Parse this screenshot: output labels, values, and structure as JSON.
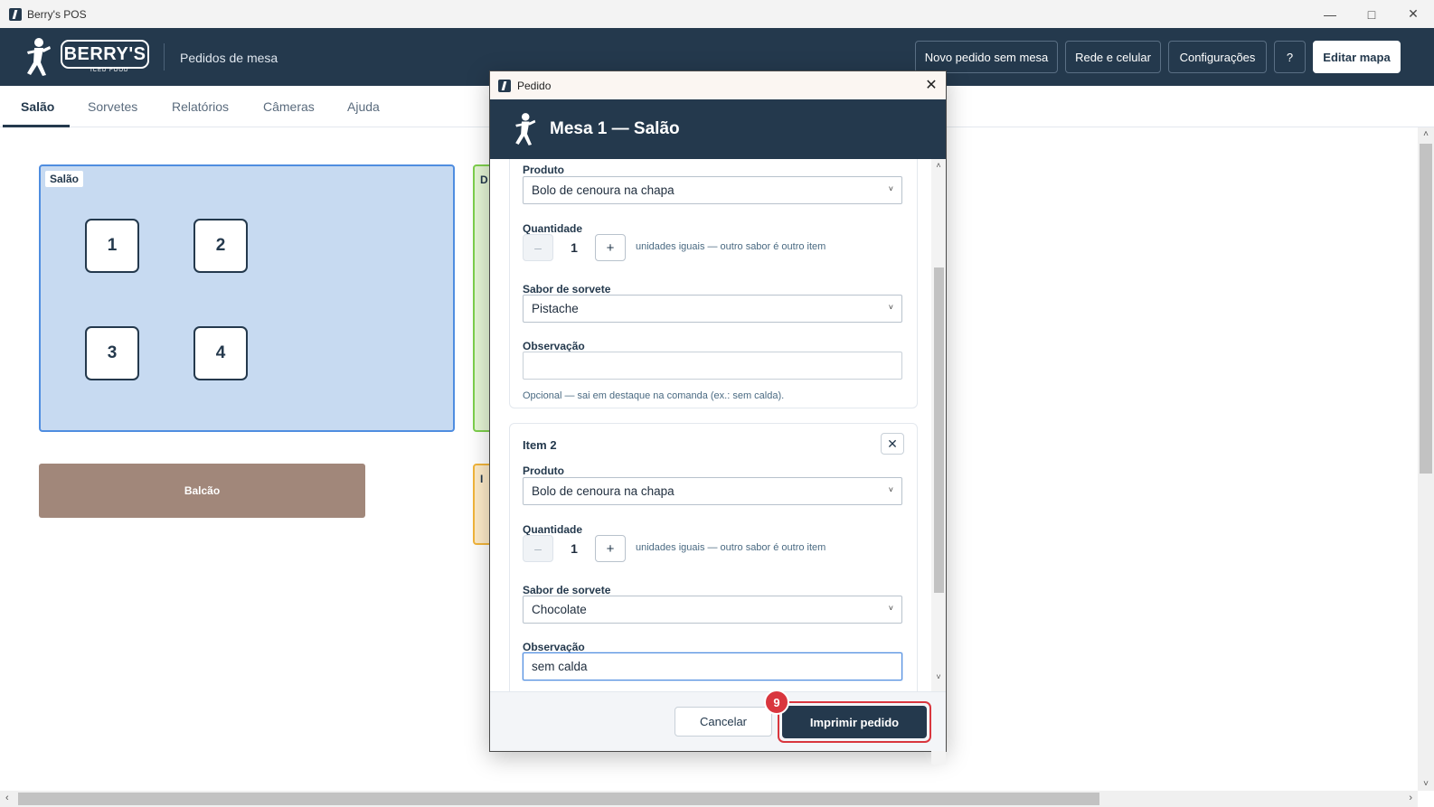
{
  "window": {
    "title": "Berry's POS"
  },
  "header": {
    "logo_text": "BERRY'S",
    "logo_subtext": "ICED FOOD",
    "section_title": "Pedidos de mesa",
    "buttons": {
      "new_order": "Novo pedido sem mesa",
      "network": "Rede e celular",
      "settings": "Configurações",
      "help": "?",
      "edit_map": "Editar mapa"
    }
  },
  "tabs": [
    "Salão",
    "Sorvetes",
    "Relatórios",
    "Câmeras",
    "Ajuda"
  ],
  "floor": {
    "areas": {
      "salao": {
        "label": "Salão",
        "tables": [
          "1",
          "2",
          "3",
          "4"
        ]
      },
      "green_label": "D",
      "orange_label": "I",
      "balcao": "Balcão"
    }
  },
  "dialog": {
    "window_title": "Pedido",
    "heading": "Mesa 1 — Salão",
    "item1": {
      "product_label": "Produto",
      "product_value": "Bolo de cenoura na chapa",
      "qty_label": "Quantidade",
      "qty_minus": "–",
      "qty_value": "1",
      "qty_plus": "+",
      "qty_hint": "unidades iguais — outro sabor é outro item",
      "flavor_label": "Sabor de sorvete",
      "flavor_value": "Pistache",
      "note_label": "Observação",
      "note_value": "",
      "note_hint": "Opcional — sai em destaque na comanda (ex.: sem calda)."
    },
    "item2": {
      "title": "Item 2",
      "remove": "✕",
      "product_label": "Produto",
      "product_value": "Bolo de cenoura na chapa",
      "qty_label": "Quantidade",
      "qty_minus": "–",
      "qty_value": "1",
      "qty_plus": "+",
      "qty_hint": "unidades iguais — outro sabor é outro item",
      "flavor_label": "Sabor de sorvete",
      "flavor_value": "Chocolate",
      "note_label": "Observação",
      "note_value": "sem calda"
    },
    "footer": {
      "cancel": "Cancelar",
      "print": "Imprimir pedido",
      "step_badge": "9"
    }
  },
  "colors": {
    "brand_navy": "#24394d",
    "salao_area": "#c7daf1",
    "balcao_area": "#a1877a",
    "highlight_red": "#d9363e"
  }
}
